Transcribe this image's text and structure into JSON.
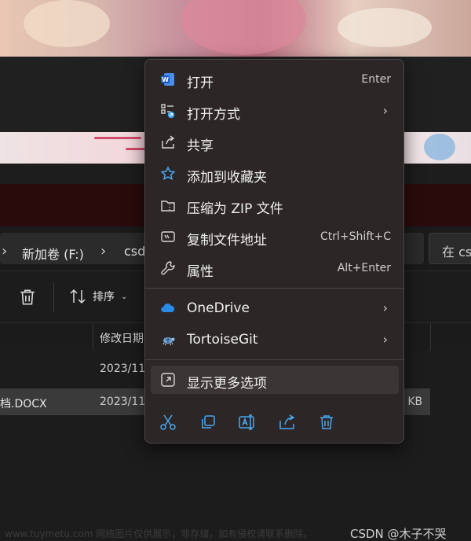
{
  "explorer": {
    "breadcrumb_drive": "新加卷 (F:)",
    "breadcrumb_folder": "csd",
    "search_placeholder": "在 cs",
    "sort_label": "排序",
    "column_date": "修改日期",
    "rows": [
      {
        "name": "",
        "date": "2023/11",
        "size": ""
      },
      {
        "name": "档.DOCX",
        "date": "2023/11",
        "size": "2 KB"
      }
    ]
  },
  "context_menu": {
    "items": [
      {
        "label": "打开",
        "shortcut": "Enter",
        "icon": "word-icon"
      },
      {
        "label": "打开方式",
        "shortcut": "",
        "icon": "open-with-icon",
        "submenu": true
      },
      {
        "label": "共享",
        "shortcut": "",
        "icon": "share-icon"
      },
      {
        "label": "添加到收藏夹",
        "shortcut": "",
        "icon": "star-icon"
      },
      {
        "label": "压缩为 ZIP 文件",
        "shortcut": "",
        "icon": "zip-folder-icon"
      },
      {
        "label": "复制文件地址",
        "shortcut": "Ctrl+Shift+C",
        "icon": "copy-path-icon"
      },
      {
        "label": "属性",
        "shortcut": "Alt+Enter",
        "icon": "wrench-icon"
      }
    ],
    "extensions": [
      {
        "label": "OneDrive",
        "icon": "onedrive-icon",
        "submenu": true
      },
      {
        "label": "TortoiseGit",
        "icon": "tortoisegit-icon",
        "submenu": true
      }
    ],
    "more_options": {
      "label": "显示更多选项",
      "icon": "show-more-icon"
    },
    "action_icons": [
      "cut-icon",
      "copy-icon",
      "rename-icon",
      "share-icon",
      "delete-icon"
    ]
  },
  "watermark": {
    "left": "www.tuymetu.com 网络图片仅供展示，非存储，如有侵权请联系删除。",
    "right": "CSDN @木子不哭"
  },
  "colors": {
    "menu_bg": "#2c2626",
    "accent_blue": "#4aa8f0",
    "highlight": "#3b3535"
  }
}
